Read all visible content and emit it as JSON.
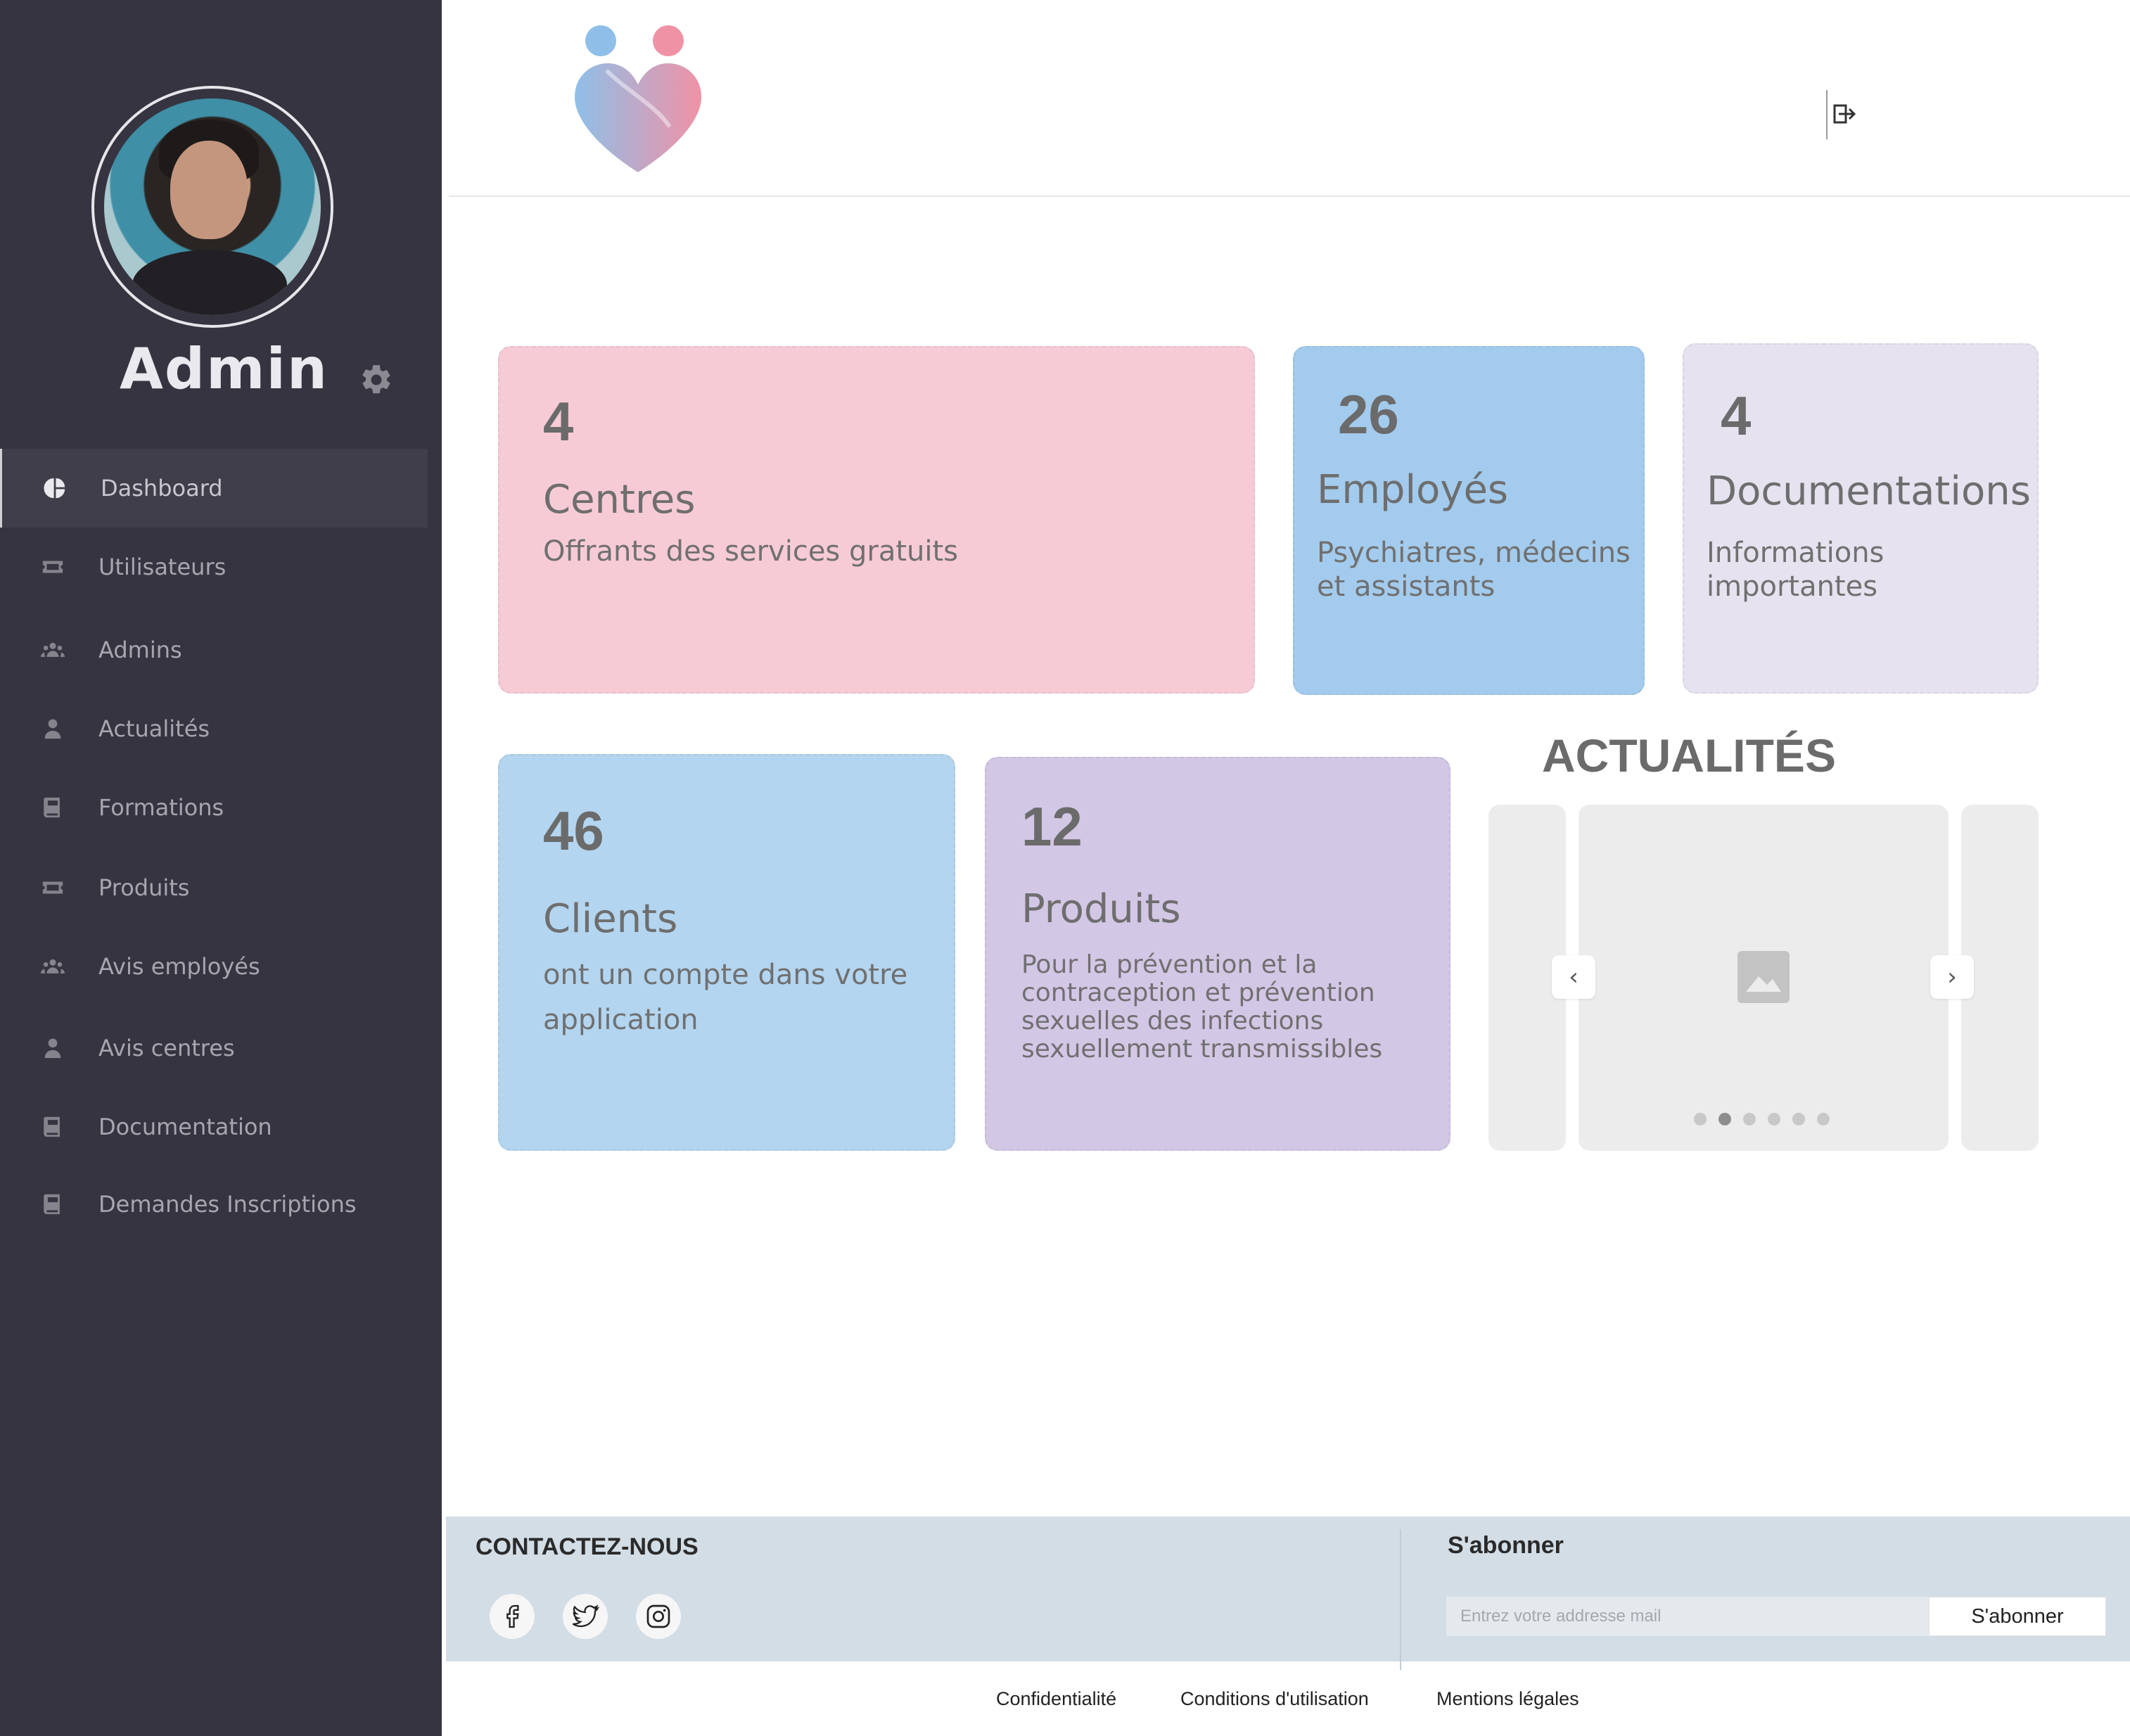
{
  "sidebar": {
    "user": {
      "name": "Admin"
    },
    "items": [
      {
        "label": "Dashboard",
        "icon": "pie-chart-icon",
        "active": true
      },
      {
        "label": "Utilisateurs",
        "icon": "ticket-icon"
      },
      {
        "label": "Admins",
        "icon": "users-icon"
      },
      {
        "label": "Actualités",
        "icon": "user-icon"
      },
      {
        "label": "Formations",
        "icon": "book-icon"
      },
      {
        "label": "Produits",
        "icon": "ticket-icon"
      },
      {
        "label": "Avis employés",
        "icon": "users-icon"
      },
      {
        "label": "Avis centres",
        "icon": "user-icon"
      },
      {
        "label": "Documentation",
        "icon": "book-icon"
      },
      {
        "label": "Demandes Inscriptions",
        "icon": "book-icon"
      }
    ]
  },
  "stats": {
    "centres": {
      "value": "4",
      "title": "Centres",
      "desc": "Offrants des services gratuits",
      "color": "#f7cbd5"
    },
    "employes": {
      "value": "26",
      "title": "Employés",
      "desc_line1": "Psychiatres, médecins",
      "desc_line2": "et assistants",
      "color": "#a3cbed"
    },
    "documentations": {
      "value": "4",
      "title": "Documentations",
      "desc_line1": "Informations",
      "desc_line2": "importantes",
      "color": "#e6e2ef"
    },
    "clients": {
      "value": "46",
      "title": "Clients",
      "desc_line1": "ont un compte dans votre",
      "desc_line2": "application",
      "color": "#b3d5f0"
    },
    "produits": {
      "value": "12",
      "title": "Produits",
      "desc_line1": "Pour la prévention et la",
      "desc_line2": "contraception et prévention",
      "desc_line3": "sexuelles des infections",
      "desc_line4": "sexuellement transmissibles",
      "color": "#d3c7e6"
    }
  },
  "news": {
    "title": "ACTUALITÉS",
    "prev_label": "‹",
    "next_label": "›",
    "slide_count": 6,
    "active_slide": 2
  },
  "footer": {
    "contact_title": "CONTACTEZ-NOUS",
    "social": [
      "facebook-icon",
      "twitter-icon",
      "instagram-icon"
    ],
    "subscribe_title": "S'abonner",
    "email_placeholder": "Entrez votre addresse mail",
    "subscribe_button": "S'abonner",
    "links": [
      "Confidentialité",
      "Conditions d'utilisation",
      "Mentions légales"
    ]
  },
  "colors": {
    "sidebar_bg": "#363440",
    "footer_bg": "#d3dde6",
    "logo_blue": "#8fbfe8",
    "logo_pink": "#f092a6"
  }
}
